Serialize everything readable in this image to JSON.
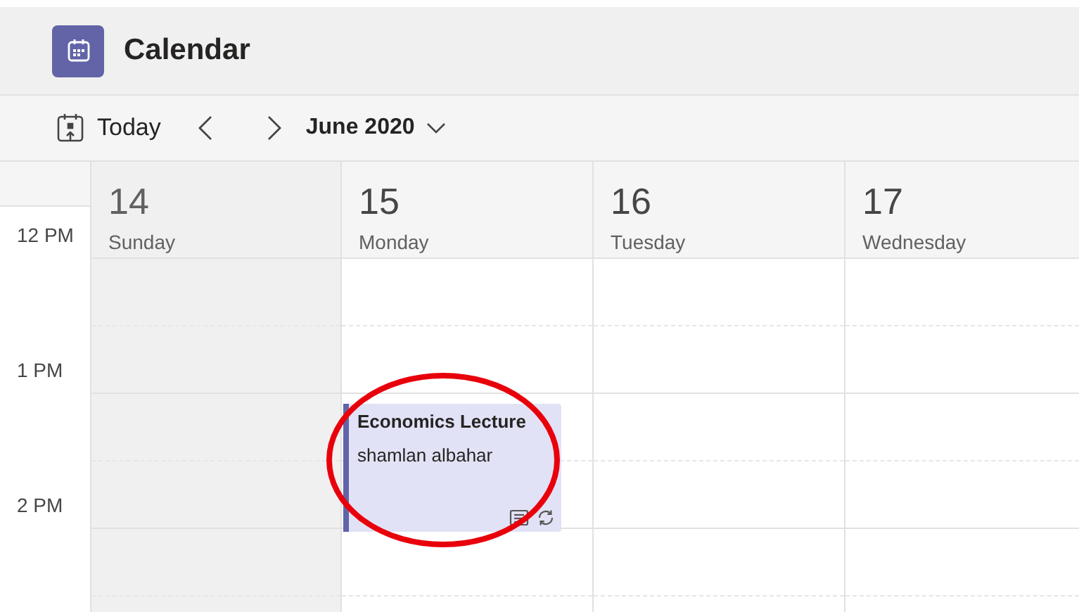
{
  "app": {
    "title": "Calendar"
  },
  "toolbar": {
    "today_label": "Today",
    "month_label": "June 2020"
  },
  "days": [
    {
      "number": "14",
      "weekday": "Sunday",
      "shaded": true
    },
    {
      "number": "15",
      "weekday": "Monday",
      "shaded": false,
      "events": [
        {
          "title": "Economics Lecture",
          "organizer": "shamlan albahar",
          "recurring": true,
          "highlighted": true
        }
      ]
    },
    {
      "number": "16",
      "weekday": "Tuesday",
      "shaded": false
    },
    {
      "number": "17",
      "weekday": "Wednesday",
      "shaded": false
    }
  ],
  "time_labels": [
    "12 PM",
    "1 PM",
    "2 PM"
  ]
}
